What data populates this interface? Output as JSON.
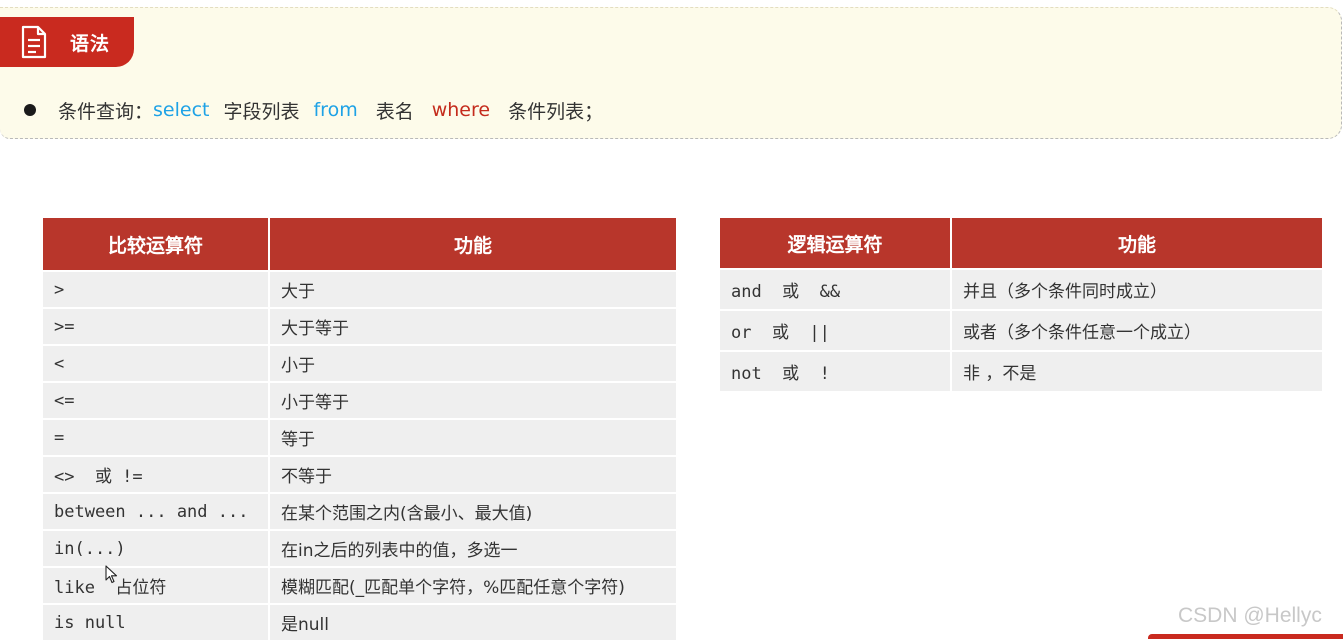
{
  "syntax": {
    "tag_label": "语法",
    "icon": "document-icon",
    "prefix": "条件查询：",
    "kw_select": "select",
    "fields": "字段列表",
    "kw_from": "from",
    "table_name": "表名",
    "kw_where": "where",
    "conditions": "条件列表；"
  },
  "comparison_table": {
    "headers": [
      "比较运算符",
      "功能"
    ],
    "rows": [
      {
        "op": ">",
        "func": "大于"
      },
      {
        "op": ">=",
        "func": "大于等于"
      },
      {
        "op": "<",
        "func": "小于"
      },
      {
        "op": "<=",
        "func": "小于等于"
      },
      {
        "op": "=",
        "func": "等于"
      },
      {
        "op": "<>  或 !=",
        "func": "不等于"
      },
      {
        "op": "between ... and ...",
        "func": "在某个范围之内(含最小、最大值)"
      },
      {
        "op": "in(...)",
        "func": "在in之后的列表中的值，多选一"
      },
      {
        "op": "like  占位符",
        "func": "模糊匹配(_匹配单个字符，%匹配任意个字符)"
      },
      {
        "op": "is null",
        "func": "是null"
      }
    ]
  },
  "logical_table": {
    "headers": [
      "逻辑运算符",
      "功能"
    ],
    "rows": [
      {
        "op": "and  或  &&",
        "func": "并且（多个条件同时成立）"
      },
      {
        "op": "or  或  ||",
        "func": "或者（多个条件任意一个成立）"
      },
      {
        "op": "not  或  !",
        "func": "非 ，不是"
      }
    ]
  },
  "watermark": "CSDN @Hellyc",
  "colors": {
    "header_red": "#b8362b",
    "tag_red": "#c92a1f",
    "keyword_blue": "#1ea2e6",
    "keyword_red": "#c42b1c",
    "row_gray": "#efefef",
    "syntax_bg": "#fdfbea"
  }
}
